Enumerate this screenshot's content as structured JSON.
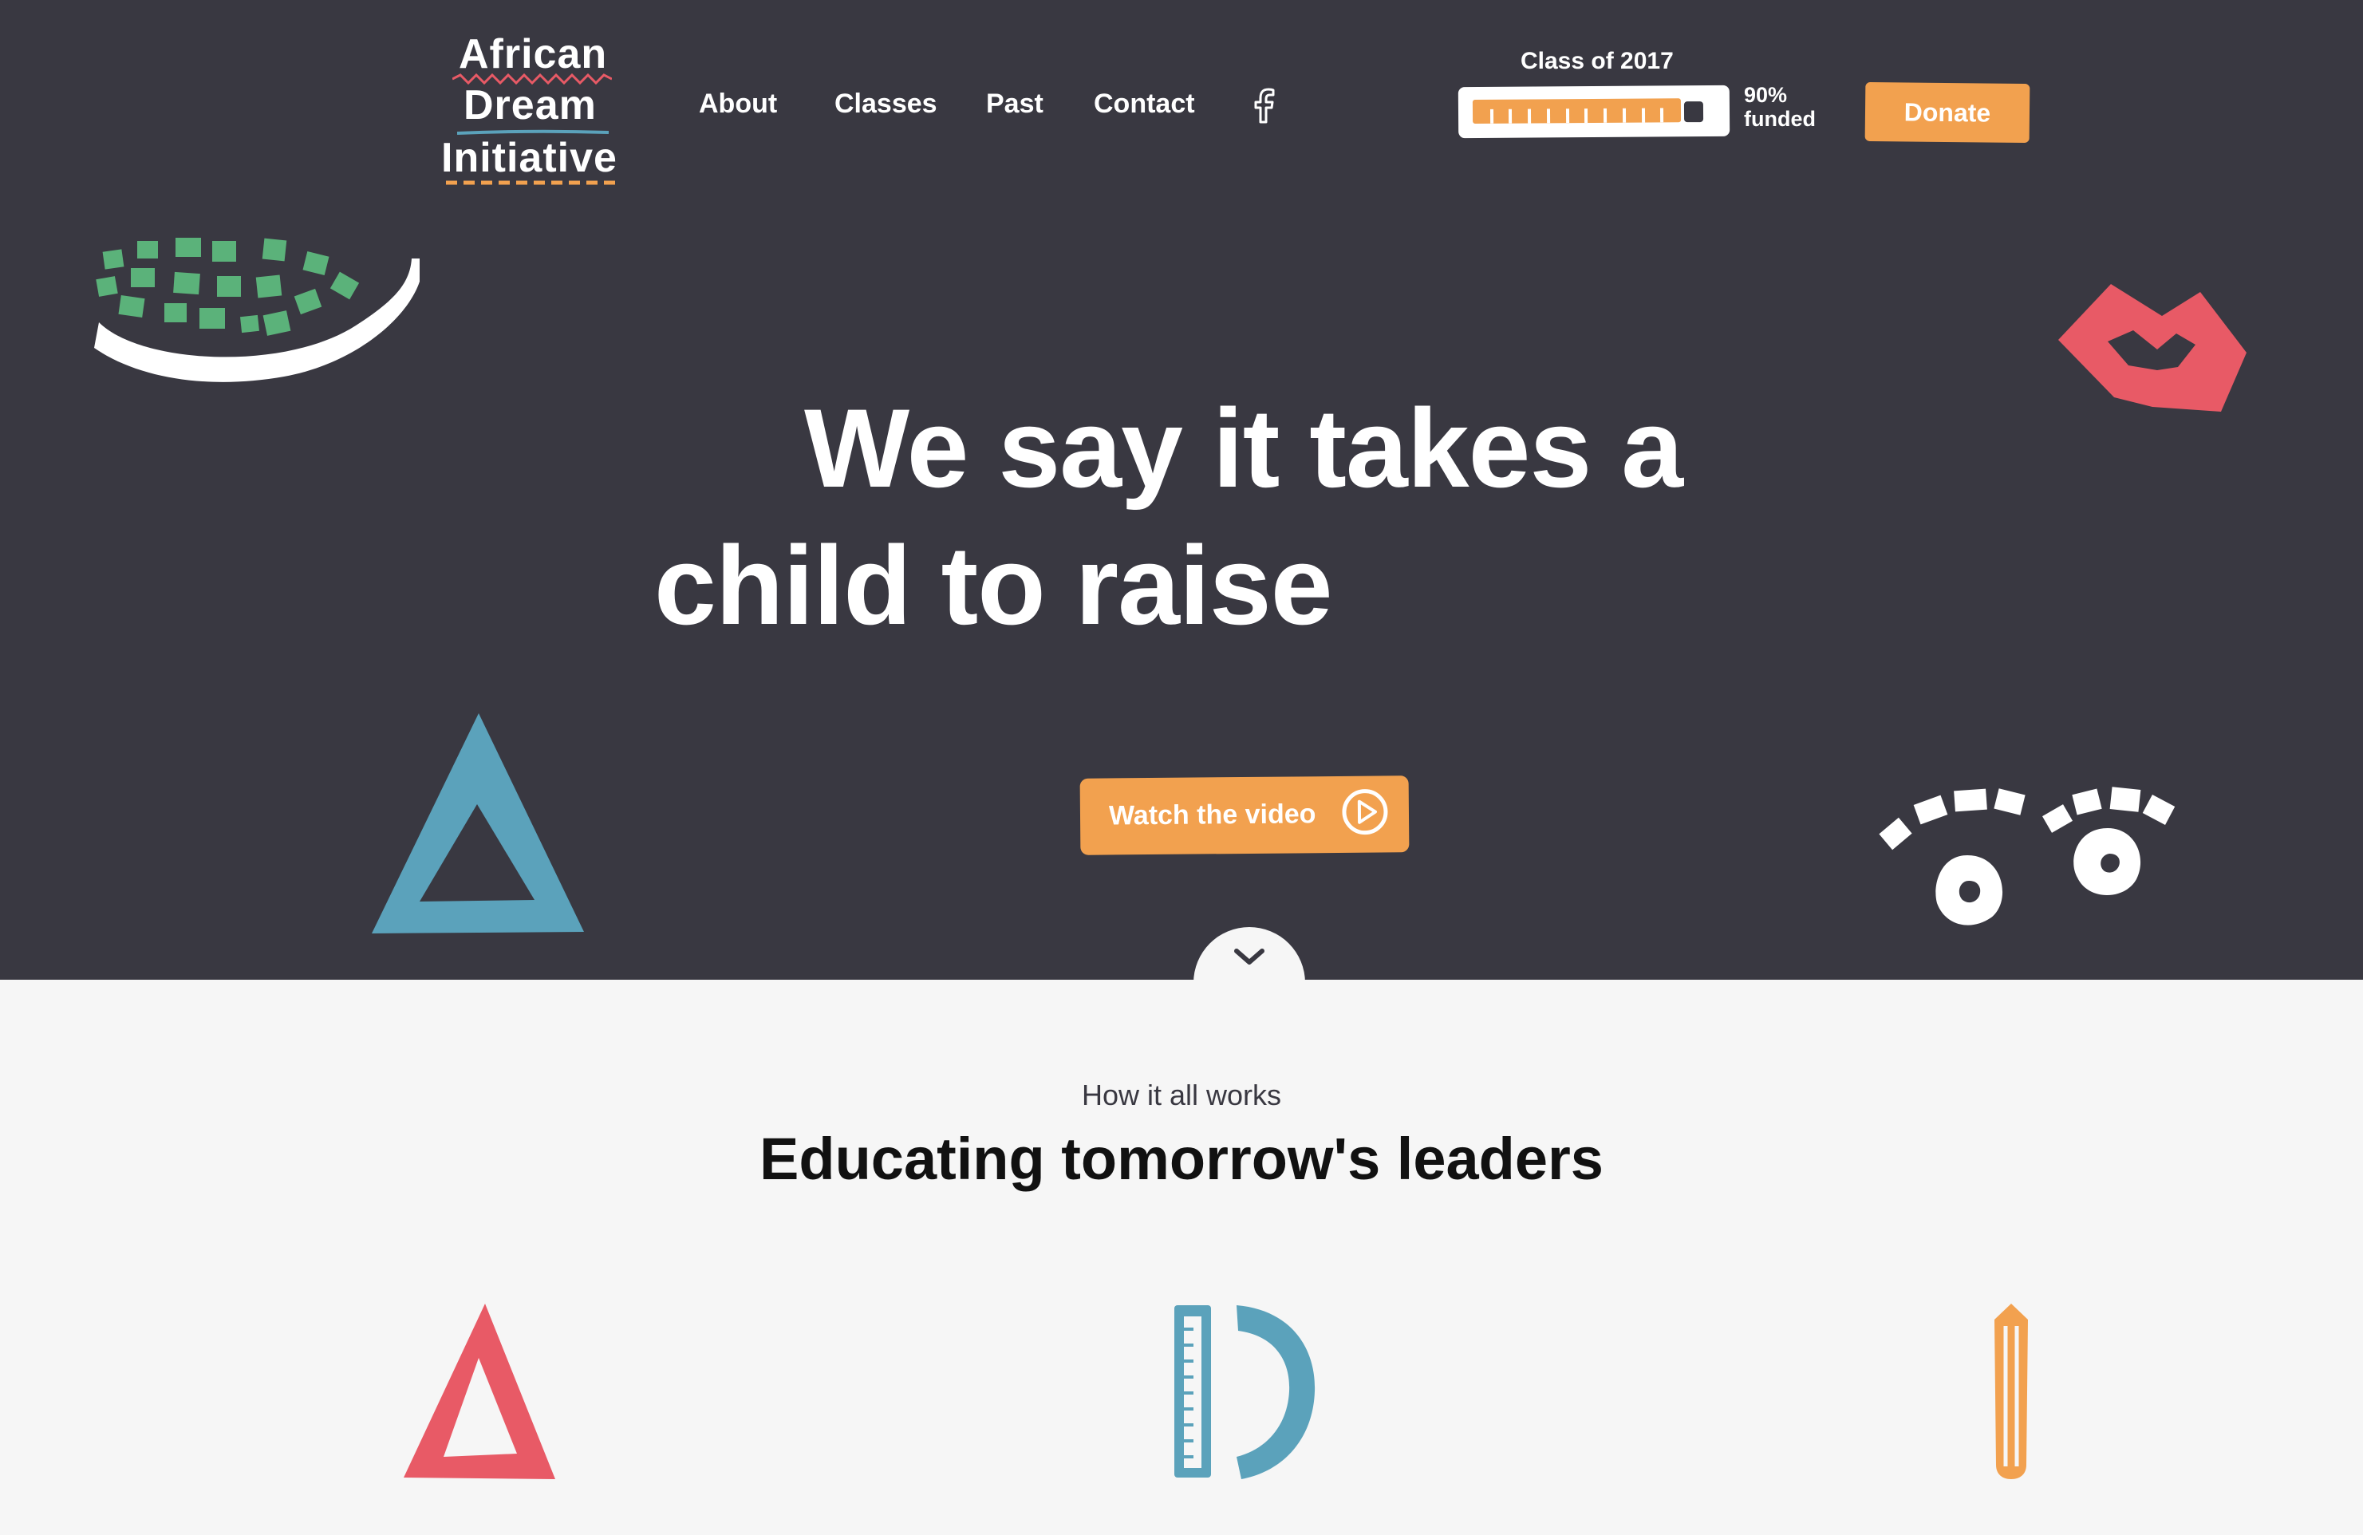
{
  "brand": {
    "logo_line1": "African",
    "logo_line2": "Dream",
    "logo_line3": "Initiative",
    "colors": {
      "dark": "#393841",
      "orange": "#f2a14f",
      "green": "#5bb27a",
      "red": "#e85a66",
      "blue": "#5ba2bb",
      "light": "#f6f6f6"
    }
  },
  "nav": {
    "items": [
      {
        "label": "About"
      },
      {
        "label": "Classes"
      },
      {
        "label": "Past"
      },
      {
        "label": "Contact"
      }
    ],
    "facebook_icon": "facebook-icon"
  },
  "funding": {
    "title": "Class of 2017",
    "percent_label": "90%",
    "funded_label": "funded",
    "progress": 0.9
  },
  "donate_label": "Donate",
  "hero": {
    "headline_line1": "We say it takes a",
    "headline_line2": "child to raise",
    "video_label": "Watch the video",
    "video_icon": "play-icon",
    "scroll_icon": "chevron-down-icon"
  },
  "section": {
    "eyebrow": "How it all works",
    "title": "Educating tomorrow's leaders"
  }
}
